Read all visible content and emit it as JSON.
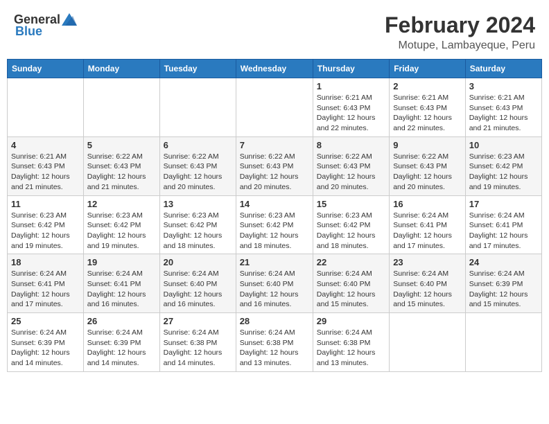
{
  "header": {
    "logo_general": "General",
    "logo_blue": "Blue",
    "title": "February 2024",
    "subtitle": "Motupe, Lambayeque, Peru"
  },
  "calendar": {
    "headers": [
      "Sunday",
      "Monday",
      "Tuesday",
      "Wednesday",
      "Thursday",
      "Friday",
      "Saturday"
    ],
    "weeks": [
      [
        {
          "day": "",
          "info": ""
        },
        {
          "day": "",
          "info": ""
        },
        {
          "day": "",
          "info": ""
        },
        {
          "day": "",
          "info": ""
        },
        {
          "day": "1",
          "info": "Sunrise: 6:21 AM\nSunset: 6:43 PM\nDaylight: 12 hours\nand 22 minutes."
        },
        {
          "day": "2",
          "info": "Sunrise: 6:21 AM\nSunset: 6:43 PM\nDaylight: 12 hours\nand 22 minutes."
        },
        {
          "day": "3",
          "info": "Sunrise: 6:21 AM\nSunset: 6:43 PM\nDaylight: 12 hours\nand 21 minutes."
        }
      ],
      [
        {
          "day": "4",
          "info": "Sunrise: 6:21 AM\nSunset: 6:43 PM\nDaylight: 12 hours\nand 21 minutes."
        },
        {
          "day": "5",
          "info": "Sunrise: 6:22 AM\nSunset: 6:43 PM\nDaylight: 12 hours\nand 21 minutes."
        },
        {
          "day": "6",
          "info": "Sunrise: 6:22 AM\nSunset: 6:43 PM\nDaylight: 12 hours\nand 20 minutes."
        },
        {
          "day": "7",
          "info": "Sunrise: 6:22 AM\nSunset: 6:43 PM\nDaylight: 12 hours\nand 20 minutes."
        },
        {
          "day": "8",
          "info": "Sunrise: 6:22 AM\nSunset: 6:43 PM\nDaylight: 12 hours\nand 20 minutes."
        },
        {
          "day": "9",
          "info": "Sunrise: 6:22 AM\nSunset: 6:43 PM\nDaylight: 12 hours\nand 20 minutes."
        },
        {
          "day": "10",
          "info": "Sunrise: 6:23 AM\nSunset: 6:42 PM\nDaylight: 12 hours\nand 19 minutes."
        }
      ],
      [
        {
          "day": "11",
          "info": "Sunrise: 6:23 AM\nSunset: 6:42 PM\nDaylight: 12 hours\nand 19 minutes."
        },
        {
          "day": "12",
          "info": "Sunrise: 6:23 AM\nSunset: 6:42 PM\nDaylight: 12 hours\nand 19 minutes."
        },
        {
          "day": "13",
          "info": "Sunrise: 6:23 AM\nSunset: 6:42 PM\nDaylight: 12 hours\nand 18 minutes."
        },
        {
          "day": "14",
          "info": "Sunrise: 6:23 AM\nSunset: 6:42 PM\nDaylight: 12 hours\nand 18 minutes."
        },
        {
          "day": "15",
          "info": "Sunrise: 6:23 AM\nSunset: 6:42 PM\nDaylight: 12 hours\nand 18 minutes."
        },
        {
          "day": "16",
          "info": "Sunrise: 6:24 AM\nSunset: 6:41 PM\nDaylight: 12 hours\nand 17 minutes."
        },
        {
          "day": "17",
          "info": "Sunrise: 6:24 AM\nSunset: 6:41 PM\nDaylight: 12 hours\nand 17 minutes."
        }
      ],
      [
        {
          "day": "18",
          "info": "Sunrise: 6:24 AM\nSunset: 6:41 PM\nDaylight: 12 hours\nand 17 minutes."
        },
        {
          "day": "19",
          "info": "Sunrise: 6:24 AM\nSunset: 6:41 PM\nDaylight: 12 hours\nand 16 minutes."
        },
        {
          "day": "20",
          "info": "Sunrise: 6:24 AM\nSunset: 6:40 PM\nDaylight: 12 hours\nand 16 minutes."
        },
        {
          "day": "21",
          "info": "Sunrise: 6:24 AM\nSunset: 6:40 PM\nDaylight: 12 hours\nand 16 minutes."
        },
        {
          "day": "22",
          "info": "Sunrise: 6:24 AM\nSunset: 6:40 PM\nDaylight: 12 hours\nand 15 minutes."
        },
        {
          "day": "23",
          "info": "Sunrise: 6:24 AM\nSunset: 6:40 PM\nDaylight: 12 hours\nand 15 minutes."
        },
        {
          "day": "24",
          "info": "Sunrise: 6:24 AM\nSunset: 6:39 PM\nDaylight: 12 hours\nand 15 minutes."
        }
      ],
      [
        {
          "day": "25",
          "info": "Sunrise: 6:24 AM\nSunset: 6:39 PM\nDaylight: 12 hours\nand 14 minutes."
        },
        {
          "day": "26",
          "info": "Sunrise: 6:24 AM\nSunset: 6:39 PM\nDaylight: 12 hours\nand 14 minutes."
        },
        {
          "day": "27",
          "info": "Sunrise: 6:24 AM\nSunset: 6:38 PM\nDaylight: 12 hours\nand 14 minutes."
        },
        {
          "day": "28",
          "info": "Sunrise: 6:24 AM\nSunset: 6:38 PM\nDaylight: 12 hours\nand 13 minutes."
        },
        {
          "day": "29",
          "info": "Sunrise: 6:24 AM\nSunset: 6:38 PM\nDaylight: 12 hours\nand 13 minutes."
        },
        {
          "day": "",
          "info": ""
        },
        {
          "day": "",
          "info": ""
        }
      ]
    ]
  }
}
